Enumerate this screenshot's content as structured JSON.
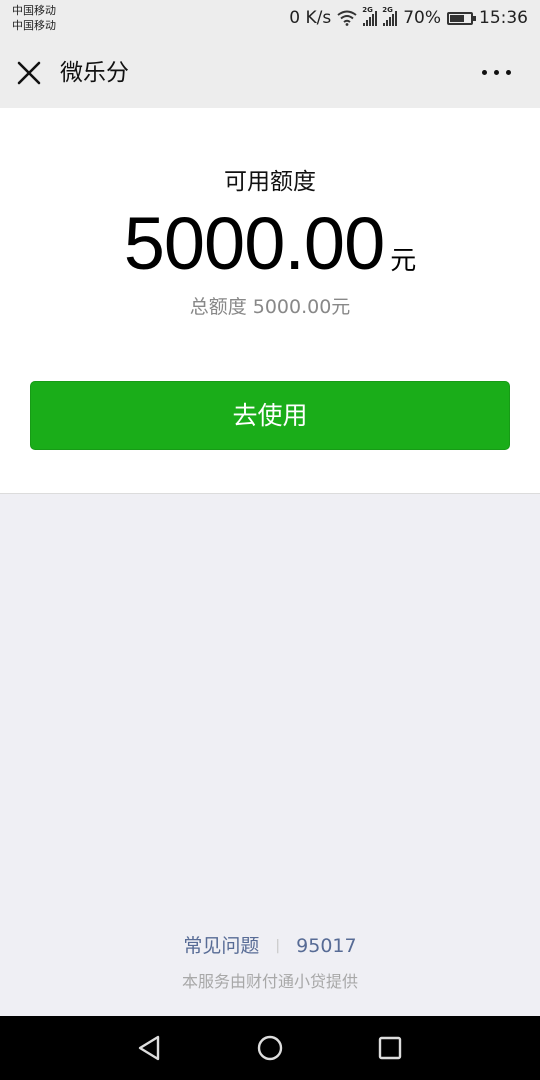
{
  "status_bar": {
    "carrier_1": "中国移动",
    "carrier_2": "中国移动",
    "network_speed": "0 K/s",
    "signal_tag_1": "2G",
    "signal_tag_2": "2G",
    "battery": "70%",
    "battery_level": 0.7,
    "time": "15:36"
  },
  "nav": {
    "close_icon": "close-icon",
    "title": "微乐分",
    "more_icon": "more-icon"
  },
  "card": {
    "available_label": "可用额度",
    "amount": "5000.00",
    "unit": "元",
    "total_text": "总额度 5000.00元",
    "use_button": "去使用"
  },
  "footer": {
    "faq": "常见问题",
    "separator": "|",
    "phone": "95017",
    "note": "本服务由财付通小贷提供"
  },
  "system_nav": {
    "back_icon": "back-triangle-icon",
    "home_icon": "home-circle-icon",
    "recent_icon": "recent-square-icon"
  },
  "colors": {
    "primary_green": "#1aad19",
    "link_blue": "#576b95",
    "background": "#efeff4"
  }
}
